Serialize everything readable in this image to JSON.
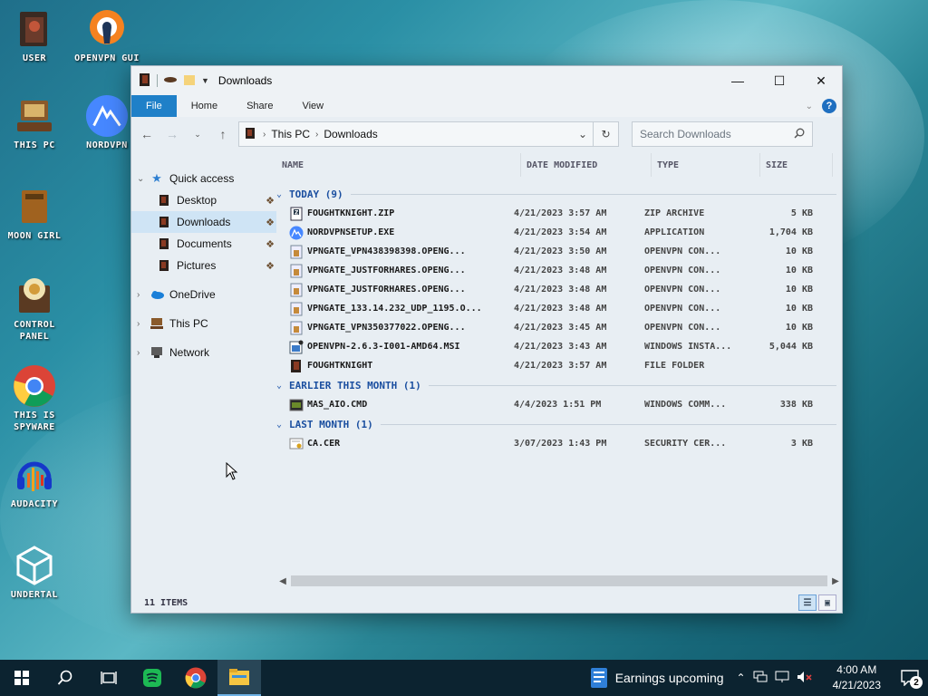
{
  "desktop": {
    "icons": [
      {
        "label": "User",
        "icon": "user-folder-icon"
      },
      {
        "label": "OpenVPN GUI",
        "icon": "openvpn-icon"
      },
      {
        "label": "This PC",
        "icon": "computer-icon"
      },
      {
        "label": "NordVPN",
        "icon": "nordvpn-icon"
      },
      {
        "label": "Moon Girl",
        "icon": "folder-icon"
      },
      {
        "label": "Control Panel",
        "icon": "control-panel-icon"
      },
      {
        "label": "This is spyware",
        "icon": "chrome-icon"
      },
      {
        "label": "Audacity",
        "icon": "audacity-icon"
      },
      {
        "label": "Undertal",
        "icon": "unity-icon"
      }
    ]
  },
  "window": {
    "title": "Downloads",
    "ribbon_tabs": [
      "File",
      "Home",
      "Share",
      "View"
    ],
    "address": {
      "segments": [
        "This PC",
        "Downloads"
      ]
    },
    "search_placeholder": "Search Downloads",
    "nav": {
      "quick_access": "Quick access",
      "quick_items": [
        "Desktop",
        "Downloads",
        "Documents",
        "Pictures"
      ],
      "onedrive": "OneDrive",
      "this_pc": "This PC",
      "network": "Network"
    },
    "columns": {
      "name": "Name",
      "date": "Date modified",
      "type": "Type",
      "size": "Size"
    },
    "groups": [
      {
        "title": "Today (9)",
        "files": [
          {
            "name": "foughtknight.zip",
            "date": "4/21/2023 3:57 AM",
            "type": "ZIP Archive",
            "size": "5 KB",
            "icon": "zip-icon"
          },
          {
            "name": "NordVPNSetup.exe",
            "date": "4/21/2023 3:54 AM",
            "type": "Application",
            "size": "1,704 KB",
            "icon": "nordvpn-icon"
          },
          {
            "name": "vpngate_vpn438398398.openg...",
            "date": "4/21/2023 3:50 AM",
            "type": "OpenVPN Con...",
            "size": "10 KB",
            "icon": "config-file-icon"
          },
          {
            "name": "vpngate_justforhares.openg...",
            "date": "4/21/2023 3:48 AM",
            "type": "OpenVPN Con...",
            "size": "10 KB",
            "icon": "config-file-icon"
          },
          {
            "name": "vpngate_justforhares.openg...",
            "date": "4/21/2023 3:48 AM",
            "type": "OpenVPN Con...",
            "size": "10 KB",
            "icon": "config-file-icon"
          },
          {
            "name": "vpngate_133.14.232_udp_1195.o...",
            "date": "4/21/2023 3:48 AM",
            "type": "OpenVPN Con...",
            "size": "10 KB",
            "icon": "config-file-icon"
          },
          {
            "name": "vpngate_vpn350377022.openg...",
            "date": "4/21/2023 3:45 AM",
            "type": "OpenVPN Con...",
            "size": "10 KB",
            "icon": "config-file-icon"
          },
          {
            "name": "OpenVPN-2.6.3-I001-amd64.msi",
            "date": "4/21/2023 3:43 AM",
            "type": "Windows Insta...",
            "size": "5,044 KB",
            "icon": "installer-icon"
          },
          {
            "name": "foughtknight",
            "date": "4/21/2023 3:57 AM",
            "type": "File folder",
            "size": "",
            "icon": "folder-icon"
          }
        ]
      },
      {
        "title": "Earlier this month (1)",
        "files": [
          {
            "name": "MAS_AIO.cmd",
            "date": "4/4/2023 1:51 PM",
            "type": "Windows Comm...",
            "size": "338 KB",
            "icon": "cmd-icon"
          }
        ]
      },
      {
        "title": "Last month (1)",
        "files": [
          {
            "name": "ca.cer",
            "date": "3/07/2023 1:43 PM",
            "type": "Security Cer...",
            "size": "3 KB",
            "icon": "certificate-icon"
          }
        ]
      }
    ],
    "status": "11 items"
  },
  "taskbar": {
    "weather_text": "Earnings upcoming",
    "time": "4:00 AM",
    "date": "4/21/2023",
    "notification_count": "2"
  },
  "colors": {
    "accent": "#1f80c8",
    "group_header": "#1b4fa0",
    "selection": "#cfe4f5",
    "taskbar": "#0c2330"
  }
}
